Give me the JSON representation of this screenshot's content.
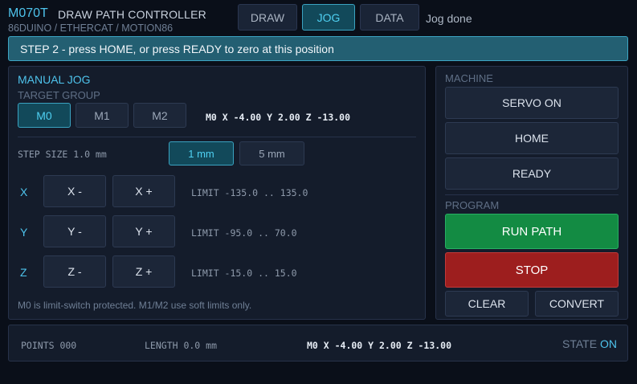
{
  "header": {
    "model": "M070T",
    "name": "DRAW PATH CONTROLLER",
    "subtitle": "86DUINO / ETHERCAT / MOTION86",
    "tabs": [
      {
        "label": "DRAW",
        "active": false
      },
      {
        "label": "JOG",
        "active": true
      },
      {
        "label": "DATA",
        "active": false
      }
    ],
    "status_text": "Jog done"
  },
  "banner": {
    "text": "STEP 2 - press HOME, or press READY to zero at this position"
  },
  "manual_jog": {
    "title": "MANUAL JOG",
    "target_group_label": "TARGET GROUP",
    "groups": [
      {
        "label": "M0",
        "selected": true
      },
      {
        "label": "M1",
        "selected": false
      },
      {
        "label": "M2",
        "selected": false
      }
    ],
    "position_readout": "M0 X -4.00 Y 2.00 Z -13.00",
    "step_size_label": "STEP SIZE 1.0 mm",
    "step_options": [
      {
        "label": "1 mm",
        "selected": true
      },
      {
        "label": "5 mm",
        "selected": false
      }
    ],
    "axes": [
      {
        "axis": "X",
        "minus": "X -",
        "plus": "X +",
        "limit": "LIMIT -135.0 .. 135.0"
      },
      {
        "axis": "Y",
        "minus": "Y -",
        "plus": "Y +",
        "limit": "LIMIT -95.0 .. 70.0"
      },
      {
        "axis": "Z",
        "minus": "Z -",
        "plus": "Z +",
        "limit": "LIMIT -15.0 .. 15.0"
      }
    ],
    "footnote": "M0 is limit-switch protected. M1/M2 use soft limits only."
  },
  "machine": {
    "label": "MACHINE",
    "servo_on": "SERVO ON",
    "home": "HOME",
    "ready": "READY"
  },
  "program": {
    "label": "PROGRAM",
    "run_path": "RUN PATH",
    "stop": "STOP",
    "clear": "CLEAR",
    "convert": "CONVERT"
  },
  "status_bar": {
    "points": "POINTS 000",
    "length": "LENGTH 0.0 mm",
    "position": "M0 X -4.00 Y 2.00 Z -13.00",
    "state_label": "STATE",
    "state_value": "ON"
  },
  "colors": {
    "accent": "#4ec3ec",
    "run": "#138b43",
    "stop": "#9d1e1e",
    "banner": "#235f72"
  }
}
